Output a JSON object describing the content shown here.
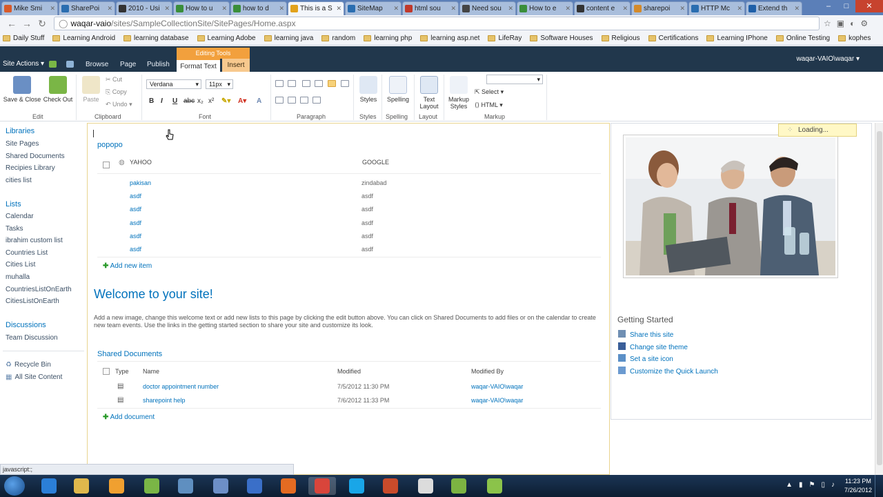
{
  "browser": {
    "tabs": [
      {
        "label": "Mike Smi",
        "color": "#d85a2a",
        "active": false
      },
      {
        "label": "SharePoi",
        "color": "#2a6db0",
        "active": false
      },
      {
        "label": "2010 - Usi",
        "color": "#333333",
        "active": false
      },
      {
        "label": "How to u",
        "color": "#3a8e3a",
        "active": false
      },
      {
        "label": "how to d",
        "color": "#3a8e3a",
        "active": false
      },
      {
        "label": "This is a S",
        "color": "#e2a21c",
        "active": true
      },
      {
        "label": "SiteMap",
        "color": "#2a6db0",
        "active": false
      },
      {
        "label": "html sou",
        "color": "#c0392b",
        "active": false
      },
      {
        "label": "Need sou",
        "color": "#444444",
        "active": false
      },
      {
        "label": "How to e",
        "color": "#3a8e3a",
        "active": false
      },
      {
        "label": "content e",
        "color": "#333333",
        "active": false
      },
      {
        "label": "sharepoi",
        "color": "#d48a2a",
        "active": false
      },
      {
        "label": "HTTP Mc",
        "color": "#2a6db0",
        "active": false
      },
      {
        "label": "Extend th",
        "color": "#1f5fa8",
        "active": false
      }
    ],
    "url_host": "waqar-vaio",
    "url_path": "/sites/SampleCollectionSite/SitePages/Home.aspx",
    "bookmarks": [
      "Daily Stuff",
      "Learning Android",
      "learning database",
      "Learning Adobe",
      "learning java",
      "random",
      "learning php",
      "learning asp.net",
      "LifeRay",
      "Software Houses",
      "Religious",
      "Certifications",
      "Learning IPhone",
      "Online Testing",
      "kophes"
    ],
    "status": "javascript:;"
  },
  "sp_header": {
    "site_actions": "Site Actions ▾",
    "tabs": [
      "Browse",
      "Page",
      "Publish"
    ],
    "contextual_group": "Editing Tools",
    "format_text": "Format Text",
    "insert": "Insert",
    "user": "waqar-VAIO\\waqar ▾"
  },
  "ribbon": {
    "save_close": "Save & Close",
    "check_out": "Check Out",
    "paste": "Paste",
    "cut": "Cut",
    "copy": "Copy",
    "undo": "Undo",
    "font_name": "Verdana",
    "font_size": "11px",
    "styles": "Styles",
    "spelling": "Spelling",
    "text_layout_1": "Text",
    "text_layout_2": "Layout",
    "markup_styles_1": "Markup",
    "markup_styles_2": "Styles",
    "select": "Select",
    "html": "HTML",
    "groups": {
      "edit": "Edit",
      "clipboard": "Clipboard",
      "font": "Font",
      "paragraph": "Paragraph",
      "styles": "Styles",
      "spelling": "Spelling",
      "layout": "Layout",
      "markup": "Markup"
    }
  },
  "quicklaunch": {
    "libraries_h": "Libraries",
    "libraries": [
      "Site Pages",
      "Shared Documents",
      "Recipies Library",
      "cities list"
    ],
    "lists_h": "Lists",
    "lists": [
      "Calendar",
      "Tasks",
      "ibrahim custom list",
      "Countries List",
      "Cities List",
      "muhalla",
      "CountriesListOnEarth",
      "CitiesListOnEarth"
    ],
    "discussions_h": "Discussions",
    "discussions": [
      "Team Discussion"
    ],
    "recycle_bin": "Recycle Bin",
    "all_content": "All Site Content"
  },
  "popopo": {
    "title": "popopo",
    "col1": "YAHOO",
    "col2": "GOOGLE",
    "rows": [
      {
        "a": "pakisan",
        "b": "zindabad"
      },
      {
        "a": "asdf",
        "b": "asdf"
      },
      {
        "a": "asdf",
        "b": "asdf"
      },
      {
        "a": "asdf",
        "b": "asdf"
      },
      {
        "a": "asdf",
        "b": "asdf"
      },
      {
        "a": "asdf",
        "b": "asdf"
      }
    ],
    "add_new": "Add new item"
  },
  "welcome": {
    "title": "Welcome to your site!",
    "body": "Add a new image, change this welcome text or add new lists to this page by clicking the edit button above. You can click on Shared Documents to add files or on the calendar to create new team events. Use the links in the getting started section to share your site and customize its look."
  },
  "shared_docs": {
    "title": "Shared Documents",
    "col_type": "Type",
    "col_name": "Name",
    "col_modified": "Modified",
    "col_modified_by": "Modified By",
    "rows": [
      {
        "name": "doctor appointment number",
        "modified": "7/5/2012 11:30 PM",
        "by": "waqar-VAIO\\waqar"
      },
      {
        "name": "sharepoint help",
        "modified": "7/6/2012 11:33 PM",
        "by": "waqar-VAIO\\waqar"
      }
    ],
    "add_doc": "Add document"
  },
  "getting_started": {
    "title": "Getting Started",
    "links": [
      "Share this site",
      "Change site theme",
      "Set a site icon",
      "Customize the Quick Launch"
    ]
  },
  "loading": "Loading...",
  "taskbar": {
    "time": "11:23 PM",
    "date": "7/26/2012",
    "apps": [
      {
        "icon": "ie-icon",
        "color": "#2b7fd8"
      },
      {
        "icon": "explorer-icon",
        "color": "#e0b84c"
      },
      {
        "icon": "media-player-icon",
        "color": "#f0a030"
      },
      {
        "icon": "people-icon",
        "color": "#7ab646"
      },
      {
        "icon": "app-window-icon",
        "color": "#5f8fc0"
      },
      {
        "icon": "visual-studio-icon",
        "color": "#6d8fc7"
      },
      {
        "icon": "word-icon",
        "color": "#3a6fc8"
      },
      {
        "icon": "firefox-icon",
        "color": "#e46b22"
      },
      {
        "icon": "chrome-icon",
        "color": "#d9453b"
      },
      {
        "icon": "skype-icon",
        "color": "#19a6e8"
      },
      {
        "icon": "tool-icon",
        "color": "#c84b2b"
      },
      {
        "icon": "notepad-icon",
        "color": "#dcdcdc"
      },
      {
        "icon": "designer-icon",
        "color": "#7cb342"
      },
      {
        "icon": "monitor-icon",
        "color": "#8bc34a"
      }
    ]
  }
}
